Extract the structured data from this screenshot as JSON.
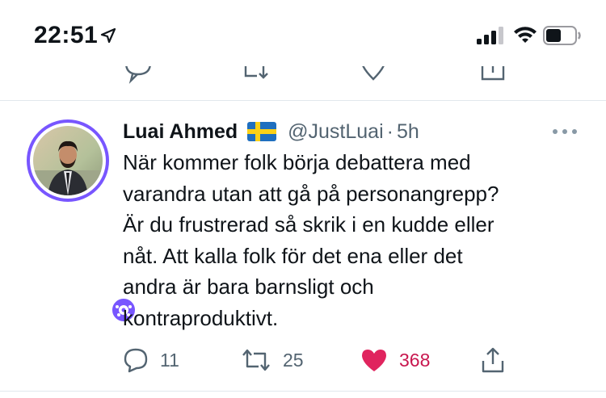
{
  "status_bar": {
    "time": "22:51",
    "icons": [
      "location-arrow-icon",
      "signal-bars-icon",
      "wifi-icon",
      "battery-icon"
    ]
  },
  "tweet": {
    "display_name": "Luai Ahmed",
    "flag": "sweden-flag-icon",
    "handle": "@JustLuai",
    "separator": "·",
    "timestamp": "5h",
    "text_lines": [
      "När kommer folk börja debattera med",
      "varandra utan att gå på personangrepp?",
      "Är du frustrerad så skrik i en kudde eller",
      "nåt. Att kalla folk för det ena eller det",
      "andra är bara barnsligt och",
      "kontraproduktivt."
    ],
    "actions": {
      "reply_count": "11",
      "retweet_count": "25",
      "like_count": "368"
    }
  },
  "colors": {
    "like_active": "#e0245e",
    "like_count": "#c8174f",
    "secondary_text": "#536471",
    "avatar_ring": "#7856ff",
    "divider": "#e1e8ed"
  }
}
